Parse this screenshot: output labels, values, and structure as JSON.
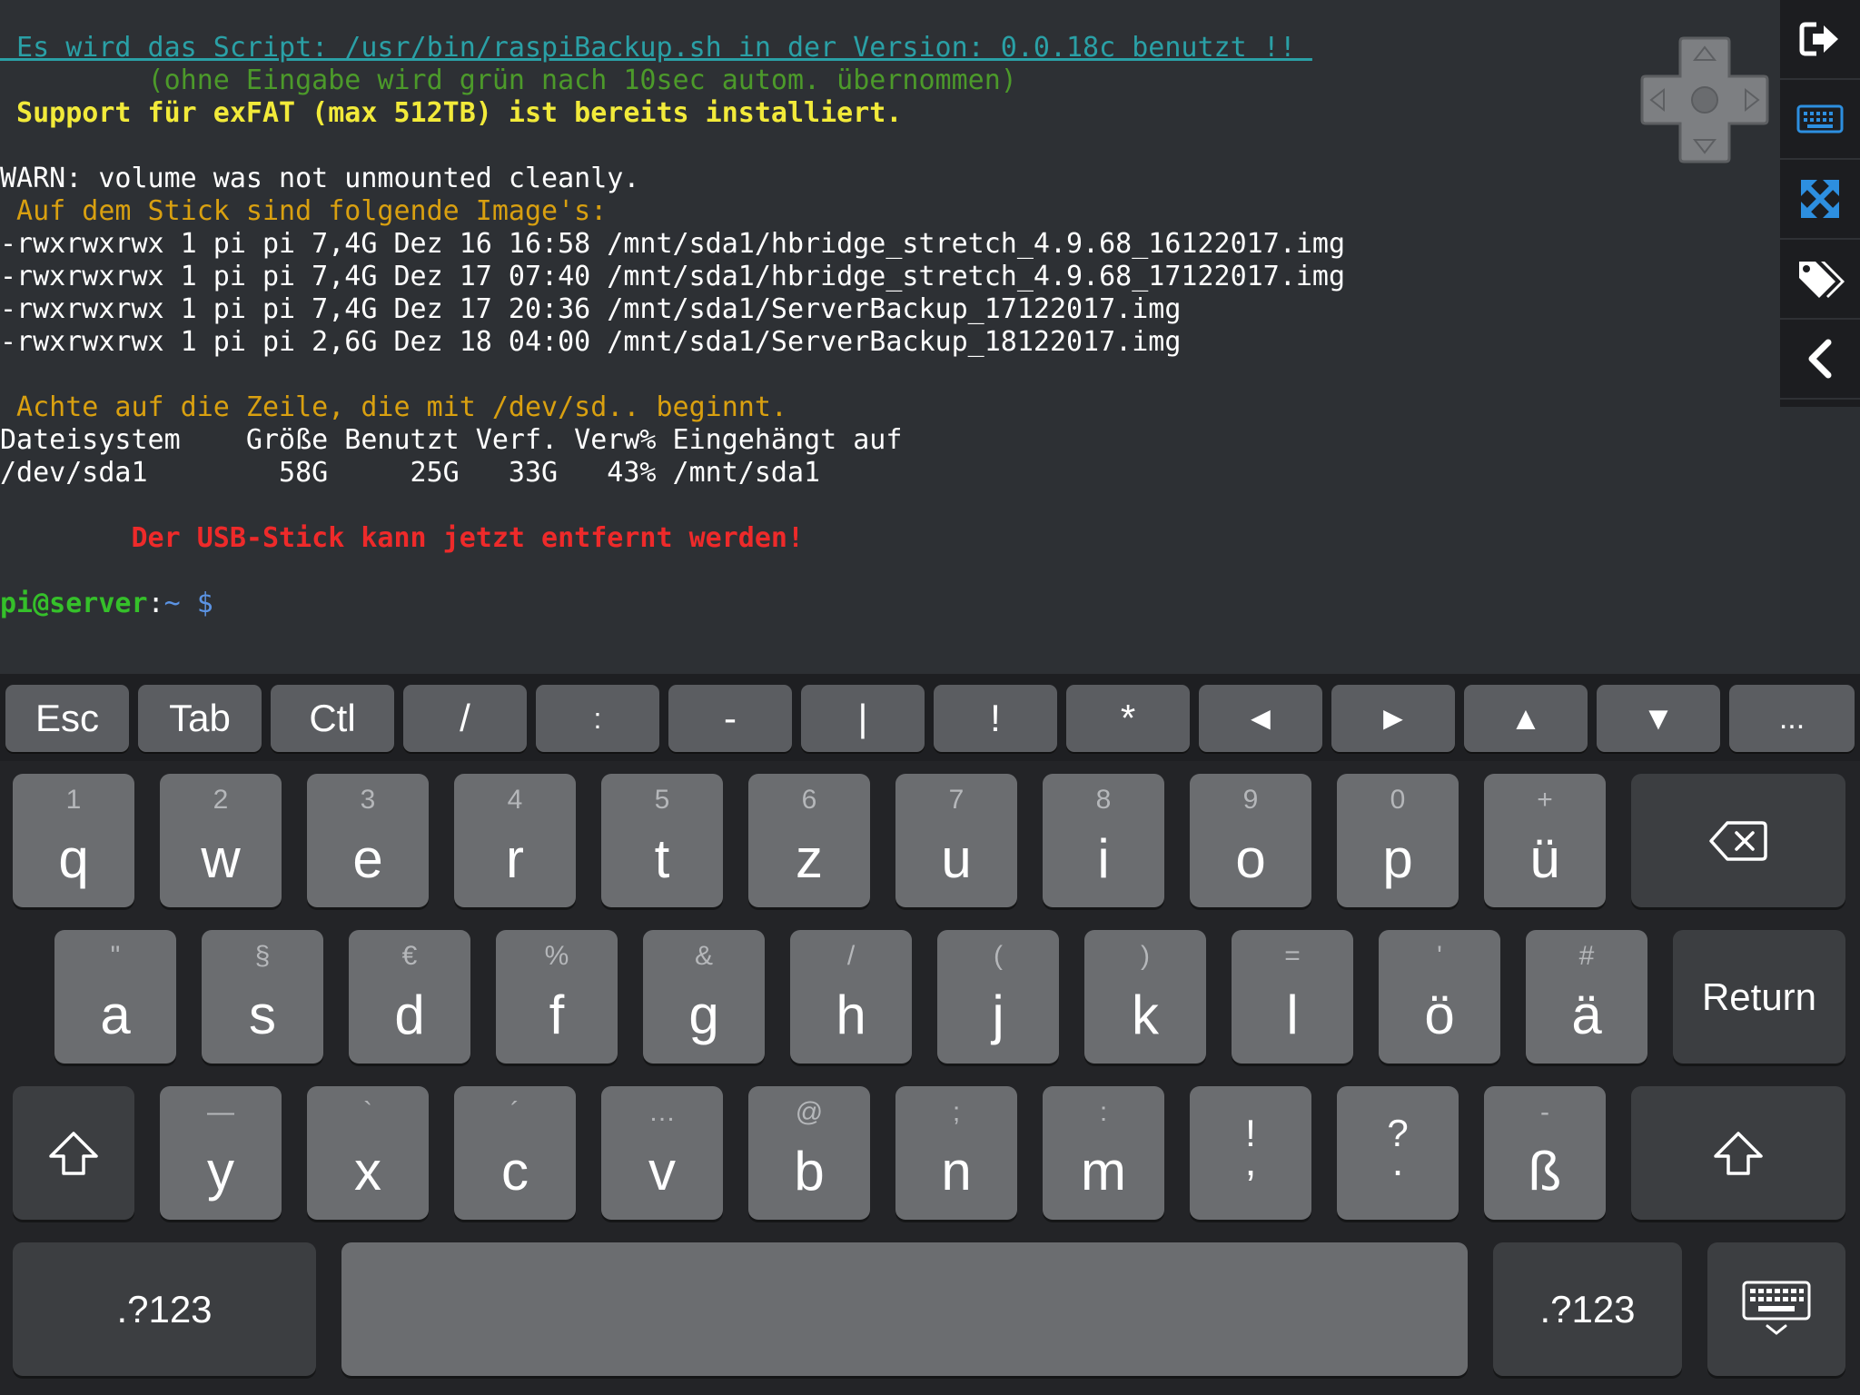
{
  "terminal": {
    "line1": " Es wird das Script: /usr/bin/raspiBackup.sh in der Version: 0.0.18c benutzt !! ",
    "line2": "         (ohne Eingabe wird grün nach 10sec autom. übernommen)",
    "line3": " Support für exFAT (max 512TB) ist bereits installiert.",
    "warn": "WARN: volume was not unmounted cleanly.",
    "images_heading": " Auf dem Stick sind folgende Image's:",
    "files": [
      "-rwxrwxrwx 1 pi pi 7,4G Dez 16 16:58 /mnt/sda1/hbridge_stretch_4.9.68_16122017.img",
      "-rwxrwxrwx 1 pi pi 7,4G Dez 17 07:40 /mnt/sda1/hbridge_stretch_4.9.68_17122017.img",
      "-rwxrwxrwx 1 pi pi 7,4G Dez 17 20:36 /mnt/sda1/ServerBackup_17122017.img",
      "-rwxrwxrwx 1 pi pi 2,6G Dez 18 04:00 /mnt/sda1/ServerBackup_18122017.img"
    ],
    "note": " Achte auf die Zeile, die mit /dev/sd.. beginnt.",
    "df_header": "Dateisystem    Größe Benutzt Verf. Verw% Eingehängt auf",
    "df_row": "/dev/sda1        58G     25G   33G   43% /mnt/sda1",
    "remove_msg": "        Der USB-Stick kann jetzt entfernt werden!",
    "prompt_user": "pi@server",
    "prompt_sep": ":",
    "prompt_path": "~ $"
  },
  "accessory_keys": [
    "Esc",
    "Tab",
    "Ctl",
    "/",
    ":",
    "-",
    "|",
    "!",
    "*",
    "◄",
    "►",
    "▲",
    "▼",
    "..."
  ],
  "keyboard": {
    "row1": [
      {
        "hint": "1",
        "main": "q"
      },
      {
        "hint": "2",
        "main": "w"
      },
      {
        "hint": "3",
        "main": "e"
      },
      {
        "hint": "4",
        "main": "r"
      },
      {
        "hint": "5",
        "main": "t"
      },
      {
        "hint": "6",
        "main": "z"
      },
      {
        "hint": "7",
        "main": "u"
      },
      {
        "hint": "8",
        "main": "i"
      },
      {
        "hint": "9",
        "main": "o"
      },
      {
        "hint": "0",
        "main": "p"
      },
      {
        "hint": "+",
        "main": "ü"
      }
    ],
    "row2": [
      {
        "hint": "\"",
        "main": "a"
      },
      {
        "hint": "§",
        "main": "s"
      },
      {
        "hint": "€",
        "main": "d"
      },
      {
        "hint": "%",
        "main": "f"
      },
      {
        "hint": "&",
        "main": "g"
      },
      {
        "hint": "/",
        "main": "h"
      },
      {
        "hint": "(",
        "main": "j"
      },
      {
        "hint": ")",
        "main": "k"
      },
      {
        "hint": "=",
        "main": "l"
      },
      {
        "hint": "'",
        "main": "ö"
      },
      {
        "hint": "#",
        "main": "ä"
      }
    ],
    "row3": [
      {
        "hint": "—",
        "main": "y"
      },
      {
        "hint": "`",
        "main": "x"
      },
      {
        "hint": "´",
        "main": "c"
      },
      {
        "hint": "…",
        "main": "v"
      },
      {
        "hint": "@",
        "main": "b"
      },
      {
        "hint": ";",
        "main": "n"
      },
      {
        "hint": ":",
        "main": "m"
      },
      {
        "hint": "!",
        "main": ","
      },
      {
        "hint": "?",
        "main": "."
      },
      {
        "hint": "-",
        "main": "ß"
      }
    ],
    "return_label": "Return",
    "numbers_label": ".?123"
  }
}
